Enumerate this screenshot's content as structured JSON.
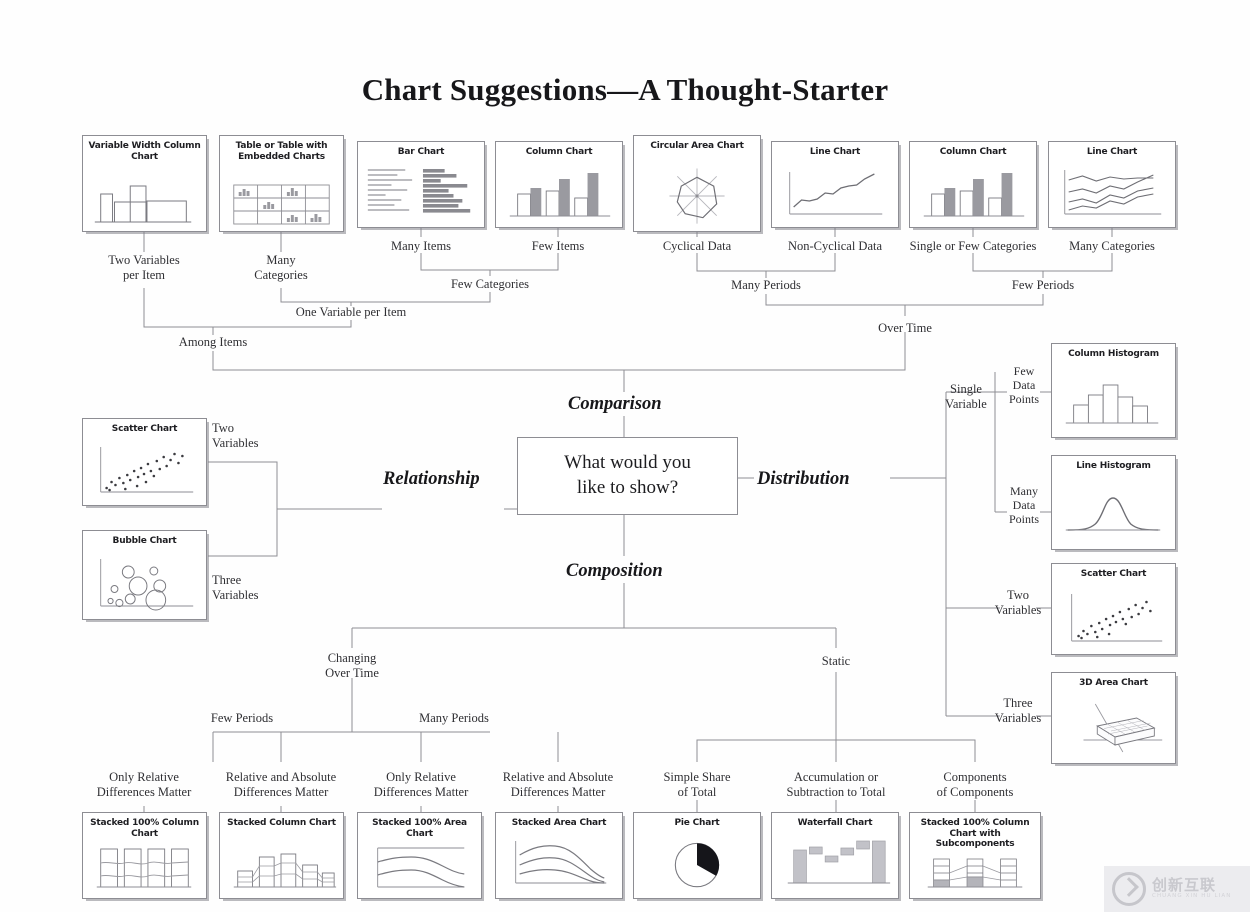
{
  "title": "Chart Suggestions—A Thought-Starter",
  "center": {
    "question_line1": "What would you",
    "question_line2": "like to show?"
  },
  "branches": {
    "comparison": "Comparison",
    "relationship": "Relationship",
    "distribution": "Distribution",
    "composition": "Composition"
  },
  "cards": {
    "variable_width_column": "Variable Width\nColumn Chart",
    "table_embedded": "Table or Table with\nEmbedded Charts",
    "bar_chart": "Bar Chart",
    "column_chart_few": "Column Chart",
    "circular_area": "Circular Area Chart",
    "line_chart_noncyc": "Line Chart",
    "column_chart_single": "Column Chart",
    "line_chart_many": "Line Chart",
    "scatter_rel": "Scatter Chart",
    "bubble": "Bubble Chart",
    "column_histogram": "Column Histogram",
    "line_histogram": "Line Histogram",
    "scatter_dist": "Scatter Chart",
    "area_3d": "3D Area Chart",
    "stacked100_column": "Stacked 100%\nColumn Chart",
    "stacked_column": "Stacked\nColumn Chart",
    "stacked100_area": "Stacked 100%\nArea Chart",
    "stacked_area": "Stacked Area Chart",
    "pie": "Pie Chart",
    "waterfall": "Waterfall Chart",
    "stacked100_sub": "Stacked 100% Column Chart\nwith Subcomponents"
  },
  "labels": {
    "two_variables_per_item": "Two Variables\nper Item",
    "many_categories_a": "Many\nCategories",
    "many_items": "Many Items",
    "few_items": "Few Items",
    "few_categories": "Few Categories",
    "one_variable_per_item": "One Variable per Item",
    "among_items": "Among Items",
    "cyclical_data": "Cyclical Data",
    "non_cyclical_data": "Non-Cyclical Data",
    "single_or_few_categories": "Single or Few Categories",
    "many_categories_b": "Many Categories",
    "many_periods_top": "Many Periods",
    "few_periods_top": "Few Periods",
    "over_time": "Over Time",
    "two_variables_rel": "Two\nVariables",
    "three_variables_rel": "Three\nVariables",
    "single_variable": "Single\nVariable",
    "few_data_points": "Few\nData\nPoints",
    "many_data_points": "Many\nData\nPoints",
    "two_variables_dist": "Two\nVariables",
    "three_variables_dist": "Three\nVariables",
    "changing_over_time": "Changing\nOver Time",
    "static": "Static",
    "few_periods_comp": "Few Periods",
    "many_periods_comp": "Many Periods",
    "only_relative_1": "Only Relative\nDifferences Matter",
    "rel_abs_1": "Relative and Absolute\nDifferences Matter",
    "only_relative_2": "Only Relative\nDifferences Matter",
    "rel_abs_2": "Relative and Absolute\nDifferences Matter",
    "simple_share": "Simple Share\nof Total",
    "accumulation": "Accumulation or\nSubtraction to Total",
    "components": "Components\nof Components"
  },
  "watermark": {
    "cn": "创新互联",
    "pinyin": "CHUANG XIN HU LIAN"
  },
  "chart_data": {
    "type": "diagram",
    "title": "Chart Suggestions—A Thought-Starter",
    "root": "What would you like to show?",
    "branches": [
      {
        "name": "Comparison",
        "children": [
          {
            "name": "Among Items",
            "children": [
              {
                "name": "Two Variables per Item",
                "chart": "Variable Width Column Chart"
              },
              {
                "name": "One Variable per Item",
                "children": [
                  {
                    "name": "Many Categories",
                    "chart": "Table or Table with Embedded Charts"
                  },
                  {
                    "name": "Few Categories",
                    "children": [
                      {
                        "name": "Many Items",
                        "chart": "Bar Chart"
                      },
                      {
                        "name": "Few Items",
                        "chart": "Column Chart"
                      }
                    ]
                  }
                ]
              }
            ]
          },
          {
            "name": "Over Time",
            "children": [
              {
                "name": "Many Periods",
                "children": [
                  {
                    "name": "Cyclical Data",
                    "chart": "Circular Area Chart"
                  },
                  {
                    "name": "Non-Cyclical Data",
                    "chart": "Line Chart"
                  }
                ]
              },
              {
                "name": "Few Periods",
                "children": [
                  {
                    "name": "Single or Few Categories",
                    "chart": "Column Chart"
                  },
                  {
                    "name": "Many Categories",
                    "chart": "Line Chart"
                  }
                ]
              }
            ]
          }
        ]
      },
      {
        "name": "Relationship",
        "children": [
          {
            "name": "Two Variables",
            "chart": "Scatter Chart"
          },
          {
            "name": "Three Variables",
            "chart": "Bubble Chart"
          }
        ]
      },
      {
        "name": "Distribution",
        "children": [
          {
            "name": "Single Variable",
            "children": [
              {
                "name": "Few Data Points",
                "chart": "Column Histogram"
              },
              {
                "name": "Many Data Points",
                "chart": "Line Histogram"
              }
            ]
          },
          {
            "name": "Two Variables",
            "chart": "Scatter Chart"
          },
          {
            "name": "Three Variables",
            "chart": "3D Area Chart"
          }
        ]
      },
      {
        "name": "Composition",
        "children": [
          {
            "name": "Changing Over Time",
            "children": [
              {
                "name": "Few Periods",
                "children": [
                  {
                    "name": "Only Relative Differences Matter",
                    "chart": "Stacked 100% Column Chart"
                  },
                  {
                    "name": "Relative and Absolute Differences Matter",
                    "chart": "Stacked Column Chart"
                  }
                ]
              },
              {
                "name": "Many Periods",
                "children": [
                  {
                    "name": "Only Relative Differences Matter",
                    "chart": "Stacked 100% Area Chart"
                  },
                  {
                    "name": "Relative and Absolute Differences Matter",
                    "chart": "Stacked Area Chart"
                  }
                ]
              }
            ]
          },
          {
            "name": "Static",
            "children": [
              {
                "name": "Simple Share of Total",
                "chart": "Pie Chart"
              },
              {
                "name": "Accumulation or Subtraction to Total",
                "chart": "Waterfall Chart"
              },
              {
                "name": "Components of Components",
                "chart": "Stacked 100% Column Chart with Subcomponents"
              }
            ]
          }
        ]
      }
    ]
  }
}
